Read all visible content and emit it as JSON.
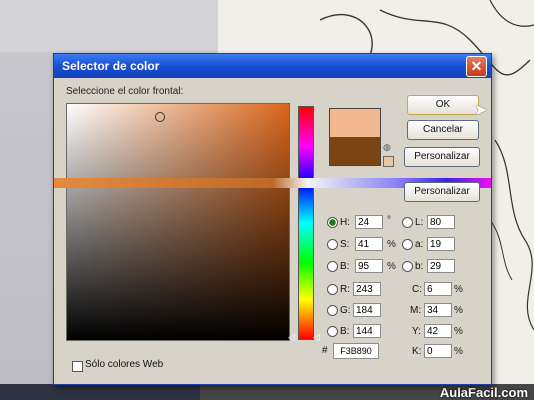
{
  "dialog": {
    "title": "Selector de color",
    "prompt": "Seleccione el color frontal:",
    "buttons": {
      "ok": "OK",
      "cancel": "Cancelar",
      "custom": "Personalizar",
      "custom2": "Personalizar"
    },
    "colors": {
      "new": "#f3b890",
      "current": "#7a4512"
    },
    "fields": [
      {
        "label": "H:",
        "value": "24",
        "unit": "°",
        "selected": true
      },
      {
        "label": "S:",
        "value": "41",
        "unit": "%"
      },
      {
        "label": "B:",
        "value": "95",
        "unit": "%"
      },
      {
        "label": "R:",
        "value": "243",
        "unit": ""
      },
      {
        "label": "G:",
        "value": "184",
        "unit": ""
      },
      {
        "label": "B:",
        "value": "144",
        "unit": ""
      }
    ],
    "lab": [
      {
        "label": "L:",
        "value": "80"
      },
      {
        "label": "a:",
        "value": "19"
      },
      {
        "label": "b:",
        "value": "29"
      }
    ],
    "cmyk": [
      {
        "label": "C:",
        "value": "6",
        "unit": "%"
      },
      {
        "label": "M:",
        "value": "34",
        "unit": "%"
      },
      {
        "label": "Y:",
        "value": "42",
        "unit": "%"
      },
      {
        "label": "K:",
        "value": "0",
        "unit": "%"
      }
    ],
    "hex_label": "#",
    "hex": "F3B890",
    "web_only": "Sólo colores Web"
  },
  "watermark": "AulaFacil.com"
}
